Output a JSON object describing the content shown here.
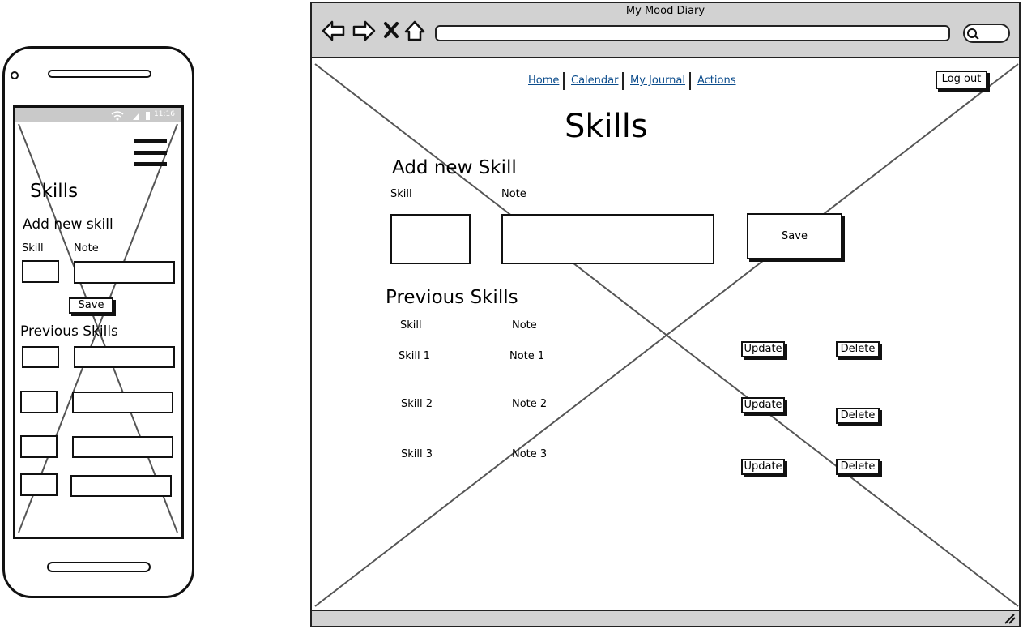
{
  "browser": {
    "title": "My Mood Diary",
    "nav": [
      "Home",
      "Calendar",
      "My Journal",
      "Actions"
    ],
    "logout_label": "Log out",
    "page_title": "Skills",
    "add_heading": "Add new Skill",
    "skill_label": "Skill",
    "note_label": "Note",
    "save_label": "Save",
    "previous_heading": "Previous Skills",
    "table": {
      "headers": [
        "Skill",
        "Note"
      ],
      "rows": [
        {
          "skill": "Skill 1",
          "note": "Note 1"
        },
        {
          "skill": "Skill 2",
          "note": "Note 2"
        },
        {
          "skill": "Skill 3",
          "note": "Note 3"
        }
      ]
    },
    "update_label": "Update",
    "delete_label": "Delete",
    "icons": [
      "back-arrow-icon",
      "forward-arrow-icon",
      "stop-icon",
      "home-icon",
      "search-icon",
      "resize-grip-icon"
    ]
  },
  "phone": {
    "time": "11:16",
    "page_title": "Skills",
    "add_heading": "Add new skill",
    "skill_label": "Skill",
    "note_label": "Note",
    "save_label": "Save",
    "previous_heading": "Previous Skills",
    "icons": [
      "camera-icon",
      "wifi-icon",
      "signal-icon",
      "battery-icon",
      "hamburger-menu-icon"
    ]
  }
}
